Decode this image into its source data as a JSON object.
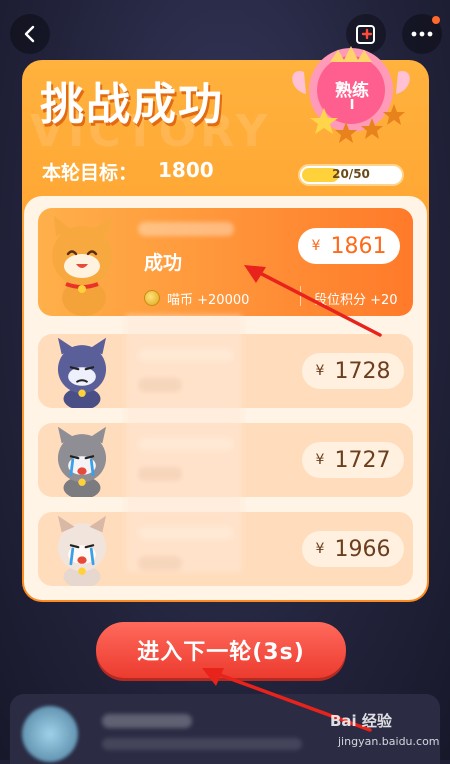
{
  "card": {
    "title": "挑战成功",
    "watermark": "VICTORY",
    "goal_label": "本轮目标：",
    "goal_value": "1800",
    "rank_line1": "熟练",
    "rank_line2": "I",
    "progress_text": "20/50",
    "progress_fraction": 0.4
  },
  "results": [
    {
      "status": "成功",
      "currency": "¥",
      "price": "1861",
      "reward_coin_label": "喵币 +20000",
      "reward_points_label": "段位积分 +20",
      "highlight": true,
      "cat_face": "happy"
    },
    {
      "currency": "¥",
      "price": "1728",
      "cat_face": "sad"
    },
    {
      "currency": "¥",
      "price": "1727",
      "cat_face": "crying"
    },
    {
      "currency": "¥",
      "price": "1966",
      "cat_face": "crying"
    }
  ],
  "next_button": "进入下一轮(3s)",
  "watermark": {
    "brand": "Bai 经验",
    "url": "jingyan.baidu.com"
  },
  "colors": {
    "card_orange": "#ff8a1f",
    "next_button": "#ec3b2f",
    "arrow": "#e8231c"
  },
  "icons": {
    "back": "chevron-left-icon",
    "share": "share-square-icon",
    "more": "more-dots-icon",
    "coin": "coin-icon"
  }
}
